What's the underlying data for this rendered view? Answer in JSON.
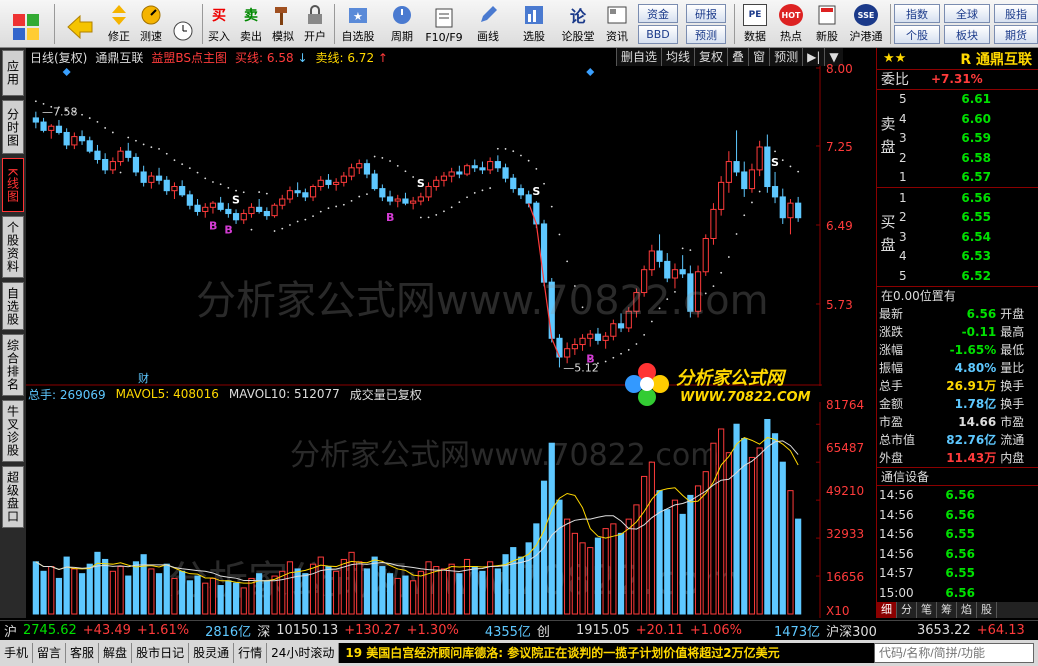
{
  "toolbar": {
    "buttons": [
      {
        "label": "",
        "name": "home"
      },
      {
        "label": "",
        "name": "back"
      },
      {
        "label": "修正",
        "name": "fix"
      },
      {
        "label": "测速",
        "name": "speedtest"
      },
      {
        "label": "买入",
        "name": "buy"
      },
      {
        "label": "卖出",
        "name": "sell"
      },
      {
        "label": "模拟",
        "name": "simulate"
      },
      {
        "label": "开户",
        "name": "open-account"
      },
      {
        "label": "自选股",
        "name": "watchlist"
      },
      {
        "label": "周期",
        "name": "period"
      },
      {
        "label": "F10/F9",
        "name": "f10"
      },
      {
        "label": "画线",
        "name": "draw"
      },
      {
        "label": "选股",
        "name": "stock-pick"
      },
      {
        "label": "论股堂",
        "name": "forum"
      },
      {
        "label": "资讯",
        "name": "news"
      },
      {
        "label": "数据",
        "name": "data"
      },
      {
        "label": "热点",
        "name": "hot"
      },
      {
        "label": "新股",
        "name": "ipo"
      },
      {
        "label": "沪港通",
        "name": "hk-connect"
      }
    ],
    "icon_texts": {
      "buy": "买",
      "sell": "卖",
      "pe": "PE",
      "hot": "HOT",
      "sse": "SSE"
    },
    "box_buttons": [
      "资金",
      "研报",
      "BBD",
      "预测",
      "指数",
      "全球",
      "股指",
      "个股",
      "板块",
      "期货"
    ]
  },
  "sidetabs": [
    "应用",
    "分时图",
    "K线图",
    "个股资料",
    "自选股",
    "综合排名",
    "牛叉诊股",
    "超级盘口"
  ],
  "chart_head": {
    "period": "日线(复权)",
    "stock": "通鼎互联",
    "indicator": "益盟BS点主图",
    "buy_line": "买线: 6.58",
    "buy_arrow": "↓",
    "sell_line": "卖线: 6.72",
    "sell_arrow": "↑"
  },
  "chart_buttons": [
    "删自选",
    "均线",
    "复权",
    "叠",
    "窗",
    "预测",
    "▶|",
    "▼"
  ],
  "price_axis": [
    "8.00",
    "7.25",
    "6.49",
    "5.73"
  ],
  "vol_axis": [
    "81764",
    "65487",
    "49210",
    "32933",
    "16656",
    "X10"
  ],
  "annotations": {
    "high_label": "7.58",
    "low_label": "5.12",
    "cai": "财"
  },
  "vol_head": {
    "total": "总手: 269069",
    "ma5": "MAVOL5: 408016",
    "ma10": "MAVOL10: 512077",
    "note": "成交量已复权"
  },
  "panel": {
    "stars": "★★",
    "name": "R 通鼎互联",
    "weibi_label": "委比",
    "weibi_value": "+7.31%",
    "sell_label": "卖盘",
    "buy_label": "买盘",
    "sells": [
      {
        "lvl": "5",
        "price": "6.61"
      },
      {
        "lvl": "4",
        "price": "6.60"
      },
      {
        "lvl": "3",
        "price": "6.59"
      },
      {
        "lvl": "2",
        "price": "6.58"
      },
      {
        "lvl": "1",
        "price": "6.57"
      }
    ],
    "buys": [
      {
        "lvl": "1",
        "price": "6.56"
      },
      {
        "lvl": "2",
        "price": "6.55"
      },
      {
        "lvl": "3",
        "price": "6.54"
      },
      {
        "lvl": "4",
        "price": "6.53"
      },
      {
        "lvl": "5",
        "price": "6.52"
      }
    ],
    "position": "在0.00位置有",
    "quotes": [
      {
        "l": "最新",
        "v": "6.56",
        "c": "green",
        "r": "开盘"
      },
      {
        "l": "涨跌",
        "v": "-0.11",
        "c": "green",
        "r": "最高"
      },
      {
        "l": "涨幅",
        "v": "-1.65%",
        "c": "green",
        "r": "最低"
      },
      {
        "l": "振幅",
        "v": "4.80%",
        "c": "cyan",
        "r": "量比"
      },
      {
        "l": "总手",
        "v": "26.91万",
        "c": "yellow",
        "r": "换手"
      },
      {
        "l": "金额",
        "v": "1.78亿",
        "c": "cyan",
        "r": "换手"
      },
      {
        "l": "市盈",
        "v": "14.66",
        "c": "white",
        "r": "市盈"
      },
      {
        "l": "总市值",
        "v": "82.76亿",
        "c": "cyan",
        "r": "流通"
      },
      {
        "l": "外盘",
        "v": "11.43万",
        "c": "red",
        "r": "内盘"
      }
    ],
    "industry": "通信设备",
    "ticks": [
      {
        "t": "14:56",
        "p": "6.56"
      },
      {
        "t": "14:56",
        "p": "6.56"
      },
      {
        "t": "14:56",
        "p": "6.55"
      },
      {
        "t": "14:56",
        "p": "6.56"
      },
      {
        "t": "14:57",
        "p": "6.55"
      },
      {
        "t": "15:00",
        "p": "6.56"
      }
    ],
    "tabs": [
      "细",
      "分",
      "笔",
      "筹",
      "焰",
      "股"
    ]
  },
  "indexbar": {
    "sh_label": "沪",
    "sh_value": "2745.62",
    "sh_change": "+43.49",
    "sh_pct": "+1.61%",
    "sh_amount": "2816亿",
    "sz_label": "深",
    "sz_value": "10150.13",
    "sz_change": "+130.27",
    "sz_pct": "+1.30%",
    "sz_amount": "4355亿",
    "cy_label": "创",
    "cy_value": "1915.05",
    "cy_change": "+20.11",
    "cy_pct": "+1.06%",
    "cy_amount": "1473亿",
    "hs_label": "沪深300",
    "hs_value": "3653.22",
    "hs_change": "+64.13"
  },
  "bottombar": {
    "items": [
      "手机",
      "留言",
      "客服",
      "解盘",
      "股市日记",
      "股灵通",
      "行情",
      "24小时滚动"
    ],
    "news": "19 美国白宫经济顾问库德洛: 参议院正在谈判的一揽子计划价值将超过2万亿美元",
    "search_placeholder": "代码/名称/简拼/功能"
  },
  "watermarks": {
    "main": "分析家公式网www.70822.com",
    "logo_cn": "分析家公式网",
    "logo_url": "WWW.70822.COM"
  },
  "colors": {
    "up": "#ff3b3b",
    "down": "#5ec8ff",
    "ma": "#ffd800",
    "bg": "#000000"
  },
  "chart_data": {
    "type": "candlestick",
    "price_ylim": [
      5.0,
      8.0
    ],
    "candles": [
      [
        7.52,
        7.58,
        7.42,
        7.48
      ],
      [
        7.48,
        7.52,
        7.38,
        7.4
      ],
      [
        7.4,
        7.46,
        7.32,
        7.44
      ],
      [
        7.44,
        7.5,
        7.36,
        7.38
      ],
      [
        7.38,
        7.42,
        7.22,
        7.26
      ],
      [
        7.26,
        7.38,
        7.22,
        7.34
      ],
      [
        7.34,
        7.4,
        7.26,
        7.3
      ],
      [
        7.3,
        7.34,
        7.18,
        7.2
      ],
      [
        7.2,
        7.26,
        7.08,
        7.12
      ],
      [
        7.12,
        7.18,
        6.98,
        7.02
      ],
      [
        7.02,
        7.14,
        6.98,
        7.1
      ],
      [
        7.1,
        7.24,
        7.06,
        7.2
      ],
      [
        7.2,
        7.28,
        7.1,
        7.14
      ],
      [
        7.14,
        7.18,
        6.96,
        7.0
      ],
      [
        7.0,
        7.06,
        6.86,
        6.9
      ],
      [
        6.9,
        7.0,
        6.84,
        6.96
      ],
      [
        6.96,
        7.04,
        6.88,
        6.92
      ],
      [
        6.92,
        6.96,
        6.78,
        6.82
      ],
      [
        6.82,
        6.9,
        6.74,
        6.86
      ],
      [
        6.86,
        6.92,
        6.76,
        6.78
      ],
      [
        6.78,
        6.82,
        6.64,
        6.68
      ],
      [
        6.68,
        6.74,
        6.58,
        6.62
      ],
      [
        6.62,
        6.7,
        6.56,
        6.66
      ],
      [
        6.66,
        6.72,
        6.6,
        6.7
      ],
      [
        6.7,
        6.76,
        6.62,
        6.64
      ],
      [
        6.64,
        6.7,
        6.56,
        6.6
      ],
      [
        6.6,
        6.64,
        6.5,
        6.54
      ],
      [
        6.54,
        6.64,
        6.5,
        6.6
      ],
      [
        6.6,
        6.7,
        6.56,
        6.66
      ],
      [
        6.66,
        6.74,
        6.6,
        6.62
      ],
      [
        6.62,
        6.66,
        6.54,
        6.58
      ],
      [
        6.58,
        6.7,
        6.56,
        6.68
      ],
      [
        6.68,
        6.78,
        6.64,
        6.74
      ],
      [
        6.74,
        6.86,
        6.7,
        6.82
      ],
      [
        6.82,
        6.9,
        6.76,
        6.8
      ],
      [
        6.8,
        6.84,
        6.72,
        6.76
      ],
      [
        6.76,
        6.88,
        6.72,
        6.86
      ],
      [
        6.86,
        6.96,
        6.82,
        6.92
      ],
      [
        6.92,
        6.98,
        6.84,
        6.88
      ],
      [
        6.88,
        6.94,
        6.82,
        6.9
      ],
      [
        6.9,
        7.0,
        6.86,
        6.96
      ],
      [
        6.96,
        7.08,
        6.92,
        7.04
      ],
      [
        7.04,
        7.12,
        6.98,
        7.08
      ],
      [
        7.08,
        7.12,
        6.94,
        6.98
      ],
      [
        6.98,
        7.02,
        6.82,
        6.84
      ],
      [
        6.84,
        6.88,
        6.72,
        6.76
      ],
      [
        6.76,
        6.82,
        6.68,
        6.72
      ],
      [
        6.72,
        6.78,
        6.66,
        6.74
      ],
      [
        6.74,
        6.8,
        6.68,
        6.7
      ],
      [
        6.7,
        6.76,
        6.64,
        6.72
      ],
      [
        6.72,
        6.8,
        6.68,
        6.76
      ],
      [
        6.76,
        6.9,
        6.72,
        6.86
      ],
      [
        6.86,
        6.96,
        6.82,
        6.92
      ],
      [
        6.92,
        7.0,
        6.86,
        6.96
      ],
      [
        6.96,
        7.04,
        6.9,
        7.0
      ],
      [
        7.0,
        7.06,
        6.94,
        6.98
      ],
      [
        6.98,
        7.08,
        6.96,
        7.06
      ],
      [
        7.06,
        7.12,
        7.0,
        7.04
      ],
      [
        7.04,
        7.1,
        6.98,
        7.02
      ],
      [
        7.02,
        7.14,
        6.98,
        7.1
      ],
      [
        7.1,
        7.16,
        7.0,
        7.04
      ],
      [
        7.04,
        7.08,
        6.9,
        6.94
      ],
      [
        6.94,
        6.98,
        6.8,
        6.84
      ],
      [
        6.84,
        6.88,
        6.74,
        6.78
      ],
      [
        6.78,
        6.82,
        6.66,
        6.7
      ],
      [
        6.7,
        6.72,
        6.46,
        6.5
      ],
      [
        6.5,
        6.54,
        5.9,
        5.94
      ],
      [
        5.94,
        5.98,
        5.36,
        5.4
      ],
      [
        5.4,
        5.44,
        5.12,
        5.22
      ],
      [
        5.22,
        5.36,
        5.16,
        5.3
      ],
      [
        5.3,
        5.4,
        5.24,
        5.34
      ],
      [
        5.34,
        5.44,
        5.28,
        5.4
      ],
      [
        5.4,
        5.48,
        5.32,
        5.44
      ],
      [
        5.44,
        5.5,
        5.34,
        5.38
      ],
      [
        5.38,
        5.46,
        5.3,
        5.42
      ],
      [
        5.42,
        5.58,
        5.38,
        5.54
      ],
      [
        5.54,
        5.64,
        5.46,
        5.5
      ],
      [
        5.5,
        5.7,
        5.46,
        5.66
      ],
      [
        5.66,
        5.88,
        5.6,
        5.84
      ],
      [
        5.84,
        6.1,
        5.8,
        6.06
      ],
      [
        6.06,
        6.3,
        6.0,
        6.24
      ],
      [
        6.24,
        6.4,
        6.08,
        6.14
      ],
      [
        6.14,
        6.22,
        5.94,
        5.98
      ],
      [
        5.98,
        6.12,
        5.88,
        6.06
      ],
      [
        6.06,
        6.2,
        5.98,
        6.02
      ],
      [
        6.02,
        6.1,
        5.6,
        5.66
      ],
      [
        5.66,
        6.1,
        5.6,
        6.04
      ],
      [
        6.04,
        6.4,
        6.0,
        6.36
      ],
      [
        6.36,
        6.7,
        6.3,
        6.64
      ],
      [
        6.64,
        6.96,
        6.58,
        6.9
      ],
      [
        6.9,
        7.2,
        6.8,
        7.1
      ],
      [
        7.1,
        7.4,
        6.96,
        7.0
      ],
      [
        7.0,
        7.1,
        6.76,
        6.84
      ],
      [
        6.84,
        7.08,
        6.8,
        7.02
      ],
      [
        7.02,
        7.3,
        6.96,
        7.24
      ],
      [
        7.24,
        7.36,
        6.8,
        6.86
      ],
      [
        6.86,
        7.0,
        6.7,
        6.76
      ],
      [
        6.76,
        6.84,
        6.5,
        6.56
      ],
      [
        6.56,
        6.74,
        6.4,
        6.7
      ],
      [
        6.7,
        6.76,
        6.52,
        6.56
      ]
    ],
    "volumes": [
      22,
      18,
      20,
      15,
      24,
      19,
      17,
      21,
      26,
      23,
      18,
      20,
      16,
      22,
      25,
      19,
      17,
      21,
      15,
      18,
      14,
      16,
      13,
      15,
      12,
      14,
      13,
      11,
      15,
      17,
      14,
      16,
      18,
      22,
      19,
      17,
      21,
      24,
      20,
      18,
      23,
      26,
      22,
      19,
      24,
      20,
      17,
      15,
      16,
      14,
      18,
      22,
      20,
      19,
      21,
      17,
      23,
      20,
      18,
      22,
      19,
      25,
      28,
      24,
      30,
      38,
      56,
      72,
      48,
      40,
      34,
      30,
      28,
      32,
      36,
      38,
      34,
      40,
      46,
      58,
      64,
      52,
      44,
      48,
      42,
      50,
      54,
      60,
      72,
      78,
      68,
      80,
      74,
      66,
      70,
      82,
      76,
      64,
      52,
      40
    ],
    "sell_marks": [
      26,
      50,
      65,
      96
    ],
    "buy_marks": [
      23,
      25,
      46,
      72
    ],
    "diamond_marks": [
      4,
      72
    ]
  }
}
